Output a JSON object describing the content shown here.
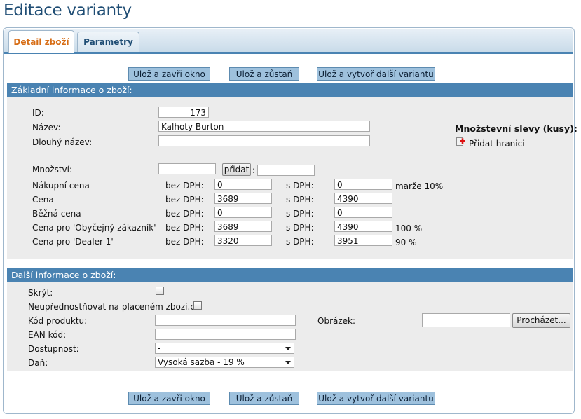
{
  "page": {
    "title": "Editace varianty"
  },
  "tabs": [
    {
      "label": "Detail zboží"
    },
    {
      "label": "Parametry"
    }
  ],
  "buttons": {
    "save_close": "Ulož a zavři okno",
    "save_stay": "Ulož a zůstaň",
    "save_new_variant": "Ulož a vytvoř další variantu"
  },
  "basic": {
    "heading": "Základní informace o zboží:",
    "id_label": "ID:",
    "id_value": "173",
    "name_label": "Název:",
    "name_value": "Kalhoty Burton",
    "long_name_label": "Dlouhý název:",
    "long_name_value": "",
    "qty_label": "Množství:",
    "qty_add_button": "přidat",
    "qty_sep": ":",
    "bez_dph": "bez DPH:",
    "s_dph": "s DPH:",
    "prices": [
      {
        "label": "Nákupní cena",
        "bez": "0",
        "s": "0",
        "note": "marže 10%"
      },
      {
        "label": "Cena",
        "bez": "3689",
        "s": "4390",
        "note": ""
      },
      {
        "label": "Běžná cena",
        "bez": "0",
        "s": "0",
        "note": ""
      },
      {
        "label": "Cena pro 'Obyčejný zákazník'",
        "bez": "3689",
        "s": "4390",
        "note": "100 %"
      },
      {
        "label": "Cena pro 'Dealer 1'",
        "bez": "3320",
        "s": "3951",
        "note": "90 %"
      }
    ],
    "discounts_title": "Množstevní slevy (kusy):",
    "add_limit_label": "Přidat hranici"
  },
  "more": {
    "heading": "Další informace o zboží:",
    "hide_label": "Skrýt:",
    "no_prefer_label": "Neupřednostňovat na placeném zbozi.cz:",
    "code_label": "Kód produktu:",
    "ean_label": "EAN kód:",
    "availability_label": "Dostupnost:",
    "availability_value": "-",
    "tax_label": "Daň:",
    "tax_value": "Vysoká sazba - 19 %",
    "image_label": "Obrázek:",
    "browse_button": "Procházet..."
  },
  "colors": {
    "accent": "#4a83b2",
    "title": "#1f4d74",
    "active_tab": "#d76d15",
    "button": "#9ec1dd"
  }
}
